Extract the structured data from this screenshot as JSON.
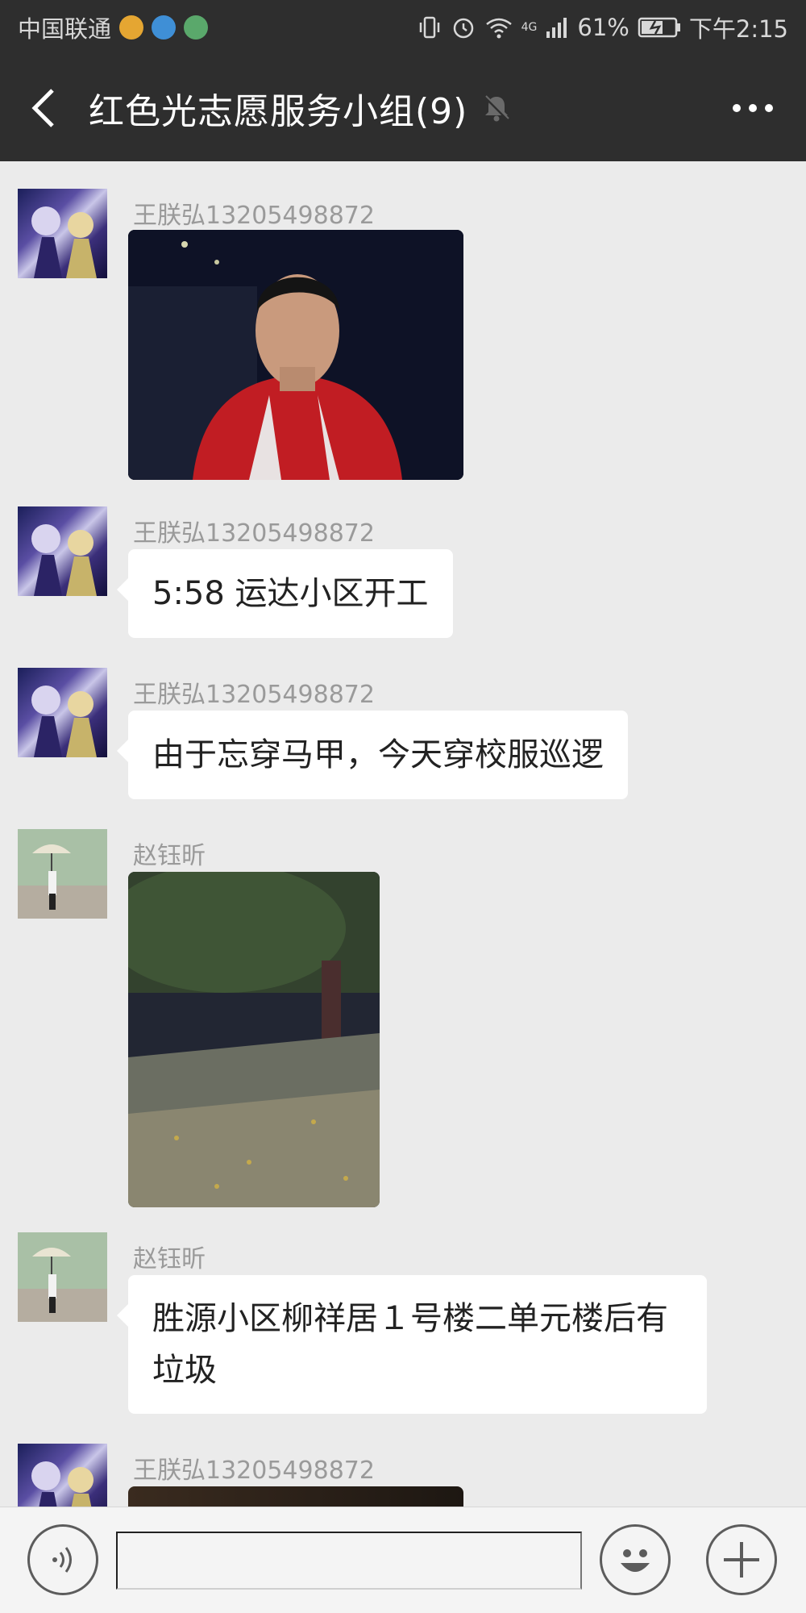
{
  "status_bar": {
    "carrier": "中国联通",
    "network": "4G",
    "battery": "61%",
    "time": "下午2:15"
  },
  "header": {
    "title": "红色光志愿服务小组(9)"
  },
  "messages": [
    {
      "sender": "王朕弘13205498872",
      "type": "image",
      "image_desc_icon": "photo-selfie"
    },
    {
      "sender": "王朕弘13205498872",
      "type": "text",
      "text": "5:58 运达小区开工"
    },
    {
      "sender": "王朕弘13205498872",
      "type": "text",
      "text": "由于忘穿马甲，今天穿校服巡逻"
    },
    {
      "sender": "赵钰昕",
      "type": "image",
      "image_desc_icon": "photo-night-street"
    },
    {
      "sender": "赵钰昕",
      "type": "text",
      "text": "胜源小区柳祥居１号楼二单元楼后有垃圾"
    },
    {
      "sender": "王朕弘13205498872",
      "type": "image",
      "image_desc_icon": "photo-partial"
    }
  ],
  "colors": {
    "header_bg": "#2e2e2e",
    "chat_bg": "#ebebeb",
    "bubble_bg": "#ffffff",
    "sender_text": "#9a9a9a"
  },
  "input_bar": {
    "placeholder": ""
  }
}
